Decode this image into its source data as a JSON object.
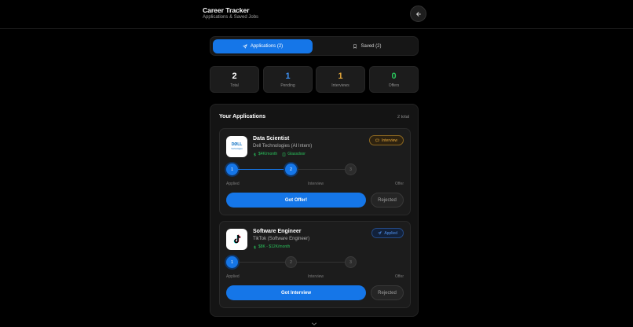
{
  "header": {
    "title": "Career Tracker",
    "subtitle": "Applications & Saved Jobs",
    "back_icon": "arrow-left-icon"
  },
  "tabs": [
    {
      "label": "Applications (2)",
      "icon": "send-icon",
      "active": true
    },
    {
      "label": "Saved (2)",
      "icon": "bookmark-icon",
      "active": false
    }
  ],
  "stats": [
    {
      "value": "2",
      "label": "Total",
      "color": "#ffffff"
    },
    {
      "value": "1",
      "label": "Pending",
      "color": "#3d8ff0"
    },
    {
      "value": "1",
      "label": "Interviews",
      "color": "#e3a63a"
    },
    {
      "value": "0",
      "label": "Offers",
      "color": "#29c15b"
    }
  ],
  "panel": {
    "title": "Your Applications",
    "count": "2 total"
  },
  "applications": [
    {
      "title": "Data Scientist",
      "company": "Dell Technologies (AI Intern)",
      "salary": "$4K/month",
      "source": "Glassdoor",
      "logo_text": "DØLL",
      "logo_sub": "Technologies",
      "status": "Interview",
      "steps": [
        "1",
        "2",
        "3"
      ],
      "step_labels": [
        "Applied",
        "Interview",
        "Offer"
      ],
      "current_step": 2,
      "primary_action": "Got Offer!",
      "reject_action": "Rejected"
    },
    {
      "title": "Software Engineer",
      "company": "TikTok (Software Engineer)",
      "salary": "$8K - $12K/month",
      "status": "Applied",
      "steps": [
        "1",
        "2",
        "3"
      ],
      "step_labels": [
        "Applied",
        "Interview",
        "Offer"
      ],
      "current_step": 1,
      "primary_action": "Got Interview",
      "reject_action": "Rejected"
    }
  ],
  "colors": {
    "accent": "#1576e8",
    "success": "#29c15b",
    "warning": "#e3a63a"
  }
}
